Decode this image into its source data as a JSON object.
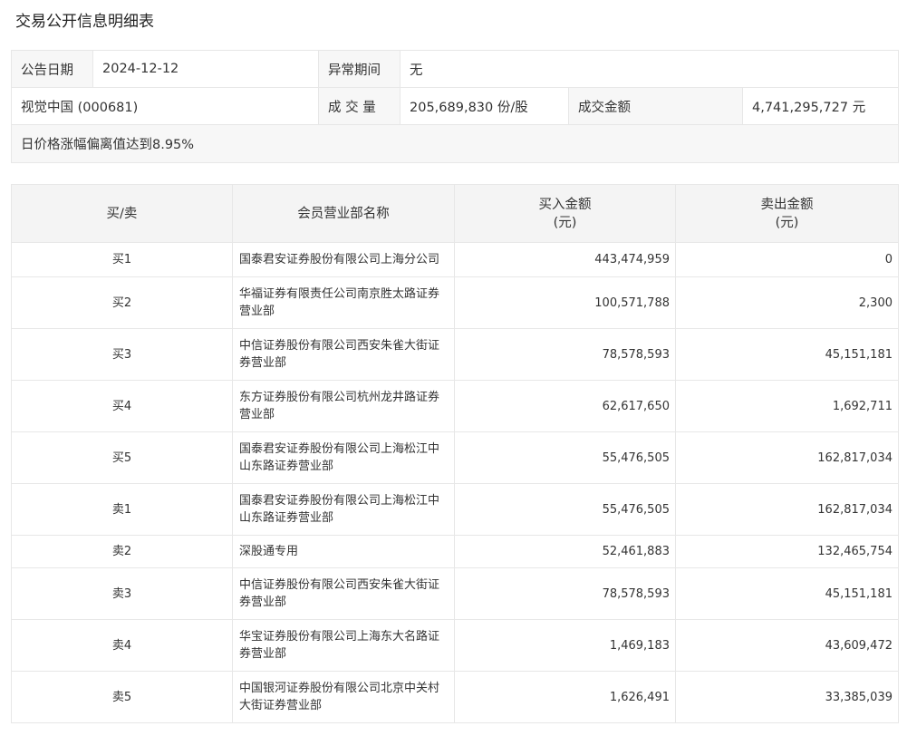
{
  "page": {
    "title": "交易公开信息明细表"
  },
  "info": {
    "date_label": "公告日期",
    "date_value": "2024-12-12",
    "period_label": "异常期间",
    "period_value": "无",
    "stock": "视觉中国 (000681)",
    "volume_label": "成 交 量",
    "volume_value": "205,689,830 份/股",
    "amount_label": "成交金额",
    "amount_value": "4,741,295,727 元",
    "reason": "日价格涨幅偏离值达到8.95%"
  },
  "table": {
    "headers": {
      "side": "买/卖",
      "name": "会员营业部名称",
      "buy_line1": "买入金额",
      "buy_line2": "(元)",
      "sell_line1": "卖出金额",
      "sell_line2": "(元)"
    },
    "rows": [
      {
        "side": "买1",
        "name": "国泰君安证券股份有限公司上海分公司",
        "buy": "443,474,959",
        "sell": "0"
      },
      {
        "side": "买2",
        "name": "华福证券有限责任公司南京胜太路证券营业部",
        "buy": "100,571,788",
        "sell": "2,300"
      },
      {
        "side": "买3",
        "name": "中信证券股份有限公司西安朱雀大街证券营业部",
        "buy": "78,578,593",
        "sell": "45,151,181"
      },
      {
        "side": "买4",
        "name": "东方证券股份有限公司杭州龙井路证券营业部",
        "buy": "62,617,650",
        "sell": "1,692,711"
      },
      {
        "side": "买5",
        "name": "国泰君安证券股份有限公司上海松江中山东路证券营业部",
        "buy": "55,476,505",
        "sell": "162,817,034"
      },
      {
        "side": "卖1",
        "name": "国泰君安证券股份有限公司上海松江中山东路证券营业部",
        "buy": "55,476,505",
        "sell": "162,817,034"
      },
      {
        "side": "卖2",
        "name": "深股通专用",
        "buy": "52,461,883",
        "sell": "132,465,754"
      },
      {
        "side": "卖3",
        "name": "中信证券股份有限公司西安朱雀大街证券营业部",
        "buy": "78,578,593",
        "sell": "45,151,181"
      },
      {
        "side": "卖4",
        "name": "华宝证券股份有限公司上海东大名路证券营业部",
        "buy": "1,469,183",
        "sell": "43,609,472"
      },
      {
        "side": "卖5",
        "name": "中国银河证券股份有限公司北京中关村大街证券营业部",
        "buy": "1,626,491",
        "sell": "33,385,039"
      }
    ]
  }
}
